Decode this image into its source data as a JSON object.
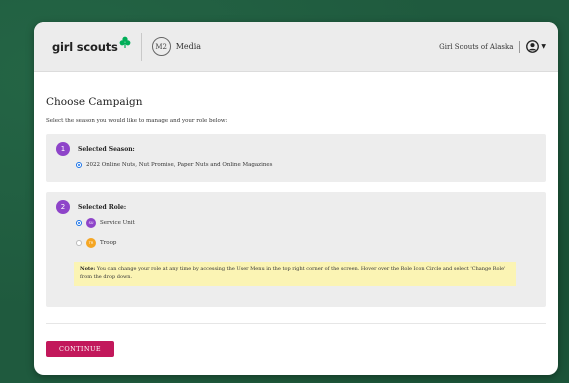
{
  "header": {
    "logo_text": "girl scouts",
    "m2_badge": "M2",
    "m2_label": "Media",
    "org_name": "Girl Scouts of Alaska"
  },
  "page": {
    "title": "Choose Campaign",
    "subtitle": "Select the season you would like to manage and your role below:"
  },
  "season": {
    "step": "1",
    "label": "Selected Season:",
    "options": [
      {
        "text": "2022 Online Nuts, Nut Promise, Paper Nuts and Online Magazines",
        "checked": true
      }
    ]
  },
  "role": {
    "step": "2",
    "label": "Selected Role:",
    "options": [
      {
        "badge": "SU",
        "text": "Service Unit",
        "checked": true,
        "badge_color": "#8e44c9"
      },
      {
        "badge": "TR",
        "text": "Troop",
        "checked": false,
        "badge_color": "#f5a623"
      }
    ],
    "note_label": "Note:",
    "note_text": "You can change your role at any time by accessing the User Menu in the top right corner of the screen. Hover over the Role Icon Circle and select 'Change Role' from the drop down."
  },
  "actions": {
    "continue_label": "CONTINUE"
  },
  "colors": {
    "accent": "#c2185b",
    "step_circle": "#8e44c9",
    "note_bg": "#fbf4b4",
    "brand_green": "#00ae58"
  }
}
